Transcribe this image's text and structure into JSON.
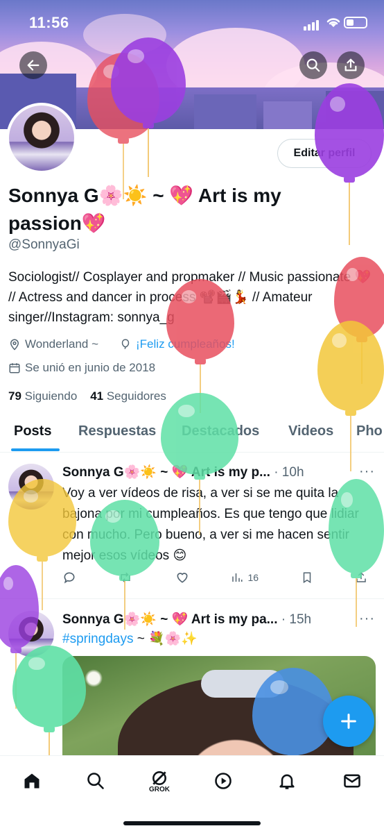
{
  "status_bar": {
    "time": "11:56"
  },
  "profile": {
    "name": "Sonnya G🌸☀️ ~ 💖 Art is my passion💖",
    "handle": "@SonnyaGi",
    "edit_label": "Editar perfil",
    "bio": "Sociologist// Cosplayer and propmaker // Music passionate 💖 // Actress and dancer in process 📽️🎬💃 // Amateur singer//Instagram: sonnya_g",
    "location": "Wonderland ~",
    "birthday": "¡Feliz cumpleaños!",
    "joined": "Se unió en junio de 2018",
    "following_count": "79",
    "following_label": "Siguiendo",
    "followers_count": "41",
    "followers_label": "Seguidores"
  },
  "tabs": [
    "Posts",
    "Respuestas",
    "Destacados",
    "Videos",
    "Pho"
  ],
  "posts": [
    {
      "author": "Sonnya G🌸☀️ ~ 💖 Art is my p...",
      "time": "· 10h",
      "text": "Voy a ver vídeos de risa, a ver si se me quita la bajona por mi cumpleaños. Es que tengo que lidiar con mucho. Pero bueno,  a ver si me hacen sentir mejor esos vídeos 😊",
      "views": "16"
    },
    {
      "author": "Sonnya G🌸☀️ ~ 💖 Art is my pa...",
      "time": "· 15h",
      "hashtag": "#springdays",
      "text_after": " ~ 💐🌸✨"
    }
  ],
  "bottom_nav": {
    "grok_label": "GROK"
  },
  "colors": {
    "accent": "#1d9bf0",
    "balloon_red": "#e8505f",
    "balloon_purple": "#9b3fe0",
    "balloon_yellow": "#f3c73a",
    "balloon_green": "#5fe0a6",
    "balloon_blue": "#4a90e2"
  }
}
